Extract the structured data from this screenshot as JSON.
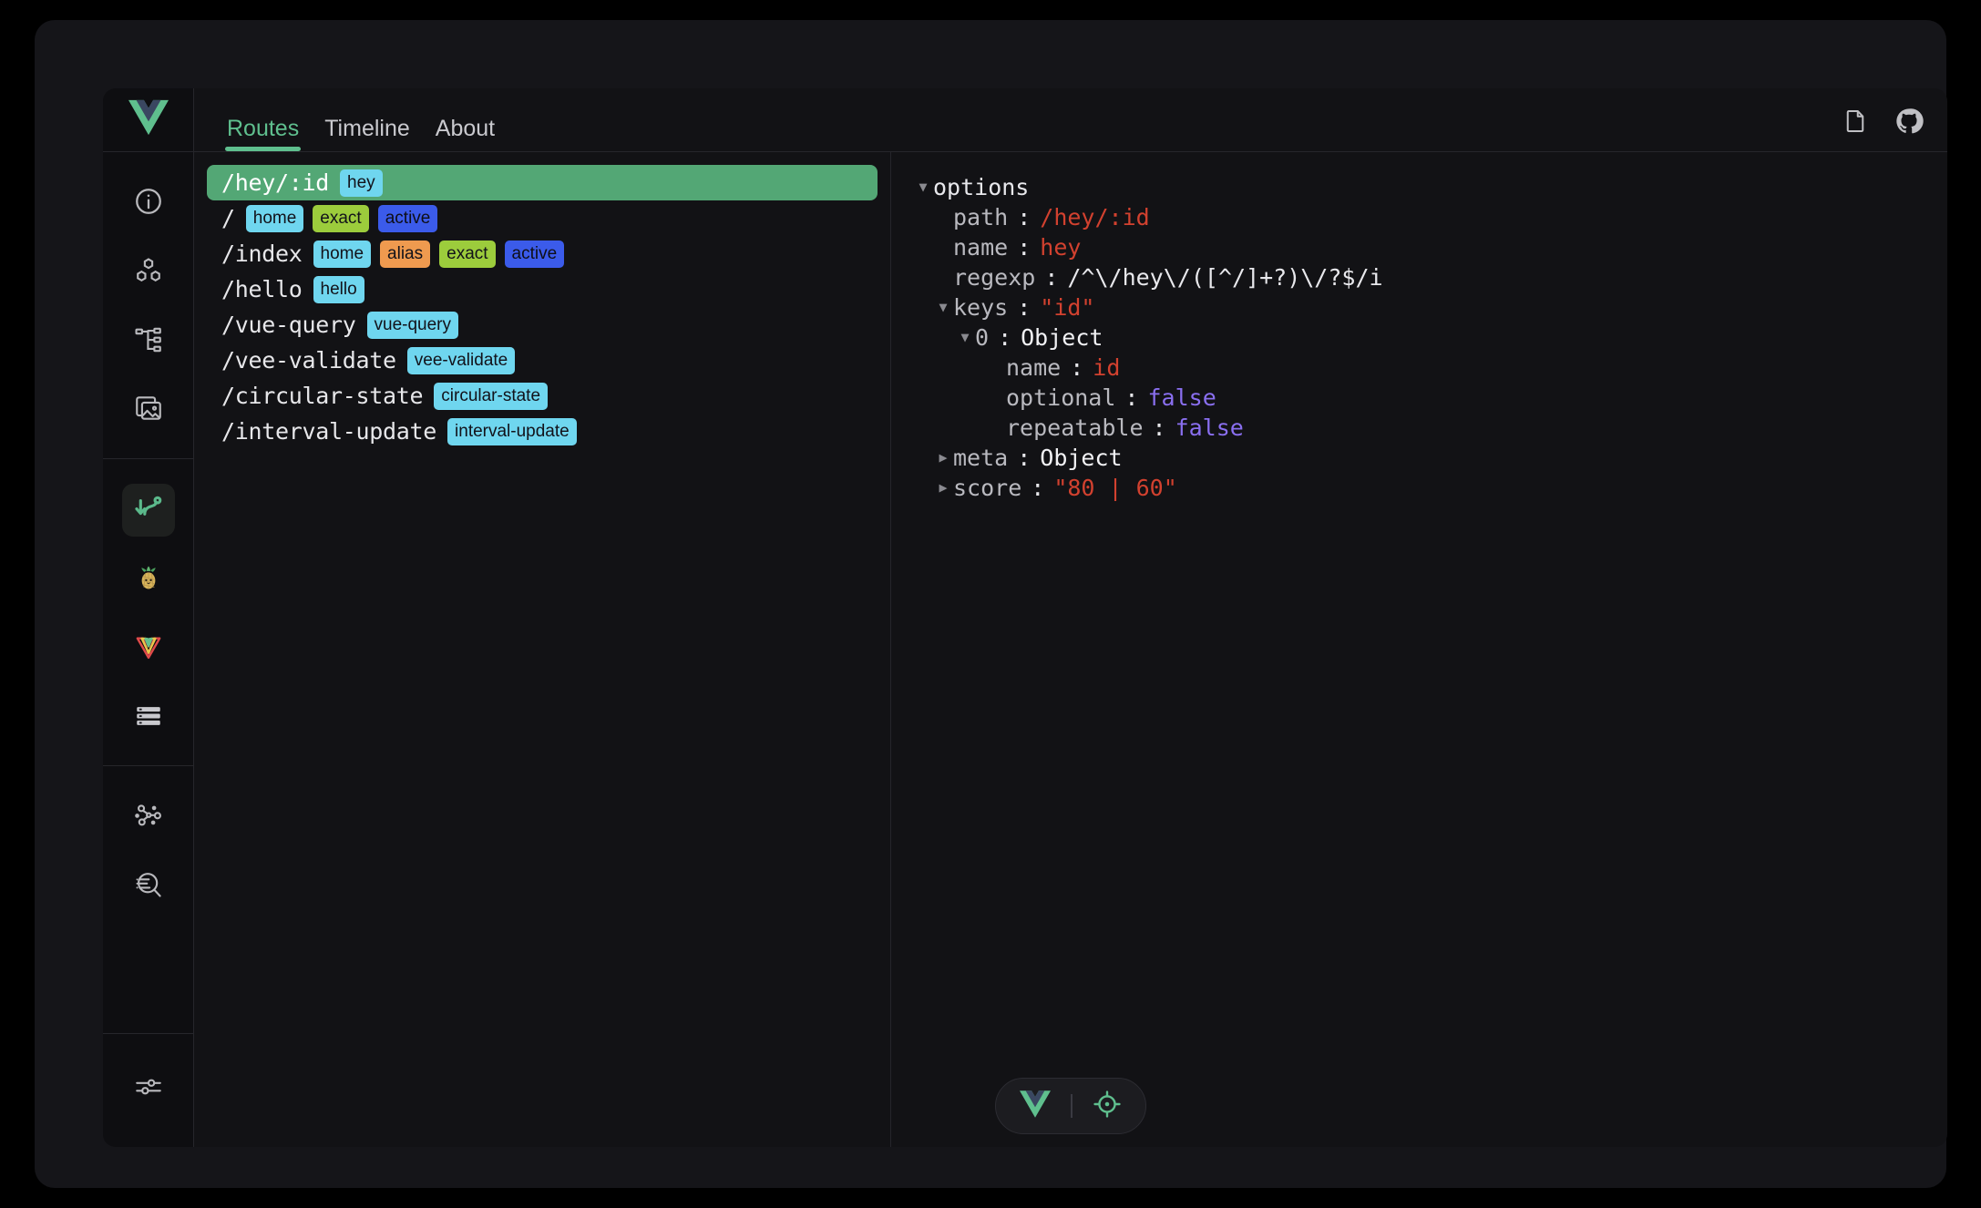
{
  "window": {
    "logo_icon": "vue-logo-icon"
  },
  "tabs": [
    {
      "label": "Routes",
      "active": true
    },
    {
      "label": "Timeline",
      "active": false
    },
    {
      "label": "About",
      "active": false
    }
  ],
  "top_actions": [
    {
      "icon": "docs-page-icon",
      "name": "documentation-button"
    },
    {
      "icon": "github-icon",
      "name": "github-button"
    }
  ],
  "rail": {
    "groups": [
      {
        "items": [
          {
            "icon": "info-circle-icon",
            "name": "sidebar-item-overview",
            "active": false
          },
          {
            "icon": "components-icon",
            "name": "sidebar-item-components",
            "active": false
          },
          {
            "icon": "tree-hierarchy-icon",
            "name": "sidebar-item-pages",
            "active": false
          },
          {
            "icon": "assets-image-icon",
            "name": "sidebar-item-assets",
            "active": false
          }
        ]
      },
      {
        "items": [
          {
            "icon": "router-icon",
            "name": "sidebar-item-router",
            "active": true
          },
          {
            "icon": "pinia-pineapple-icon",
            "name": "sidebar-item-pinia",
            "active": false
          },
          {
            "icon": "vee-validate-icon",
            "name": "sidebar-item-vee-validate",
            "active": false
          },
          {
            "icon": "list-rows-icon",
            "name": "sidebar-item-vue-query",
            "active": false
          }
        ]
      },
      {
        "items": [
          {
            "icon": "graph-nodes-icon",
            "name": "sidebar-item-graph",
            "active": false
          },
          {
            "icon": "inspect-search-icon",
            "name": "sidebar-item-inspector",
            "active": false
          }
        ]
      }
    ],
    "bottom": {
      "icon": "settings-sliders-icon",
      "name": "sidebar-item-settings"
    }
  },
  "routes": [
    {
      "path": "/hey/:id",
      "selected": true,
      "badges": [
        {
          "label": "hey",
          "type": "name"
        }
      ]
    },
    {
      "path": "/",
      "selected": false,
      "badges": [
        {
          "label": "home",
          "type": "name"
        },
        {
          "label": "exact",
          "type": "exact"
        },
        {
          "label": "active",
          "type": "active"
        }
      ]
    },
    {
      "path": "/index",
      "selected": false,
      "badges": [
        {
          "label": "home",
          "type": "name"
        },
        {
          "label": "alias",
          "type": "alias"
        },
        {
          "label": "exact",
          "type": "exact"
        },
        {
          "label": "active",
          "type": "active"
        }
      ]
    },
    {
      "path": "/hello",
      "selected": false,
      "badges": [
        {
          "label": "hello",
          "type": "name"
        }
      ]
    },
    {
      "path": "/vue-query",
      "selected": false,
      "badges": [
        {
          "label": "vue-query",
          "type": "name"
        }
      ]
    },
    {
      "path": "/vee-validate",
      "selected": false,
      "badges": [
        {
          "label": "vee-validate",
          "type": "name"
        }
      ]
    },
    {
      "path": "/circular-state",
      "selected": false,
      "badges": [
        {
          "label": "circular-state",
          "type": "name"
        }
      ]
    },
    {
      "path": "/interval-update",
      "selected": false,
      "badges": [
        {
          "label": "interval-update",
          "type": "name"
        }
      ]
    }
  ],
  "detail": {
    "root": {
      "label": "options",
      "caret": "expanded"
    },
    "rows": [
      {
        "indent": 1,
        "caret": "none",
        "key": "path",
        "value": "/hey/:id",
        "value_class": "v-str"
      },
      {
        "indent": 1,
        "caret": "none",
        "key": "name",
        "value": "hey",
        "value_class": "v-str"
      },
      {
        "indent": 1,
        "caret": "none",
        "key": "regexp",
        "value": "/^\\/hey\\/([^/]+?)\\/?$/i",
        "value_class": "v-plain"
      },
      {
        "indent": 1,
        "caret": "expanded",
        "key": "keys",
        "value": "\"id\"",
        "value_class": "v-strq"
      },
      {
        "indent": 2,
        "caret": "expanded",
        "key": "0",
        "value": "Object",
        "value_class": "v-obj"
      },
      {
        "indent": 3,
        "caret": "none",
        "key": "name",
        "value": "id",
        "value_class": "v-str"
      },
      {
        "indent": 3,
        "caret": "none",
        "key": "optional",
        "value": "false",
        "value_class": "v-bool"
      },
      {
        "indent": 3,
        "caret": "none",
        "key": "repeatable",
        "value": "false",
        "value_class": "v-bool"
      },
      {
        "indent": 1,
        "caret": "collapsed",
        "key": "meta",
        "value": "Object",
        "value_class": "v-obj"
      },
      {
        "indent": 1,
        "caret": "collapsed",
        "key": "score",
        "value": "\"80 | 60\"",
        "value_class": "v-strq"
      }
    ]
  },
  "pill": {
    "items": [
      {
        "icon": "vue-logo-icon",
        "name": "pill-vue-devtools-button"
      },
      {
        "icon": "crosshair-icon",
        "name": "pill-component-inspector-button"
      }
    ]
  }
}
